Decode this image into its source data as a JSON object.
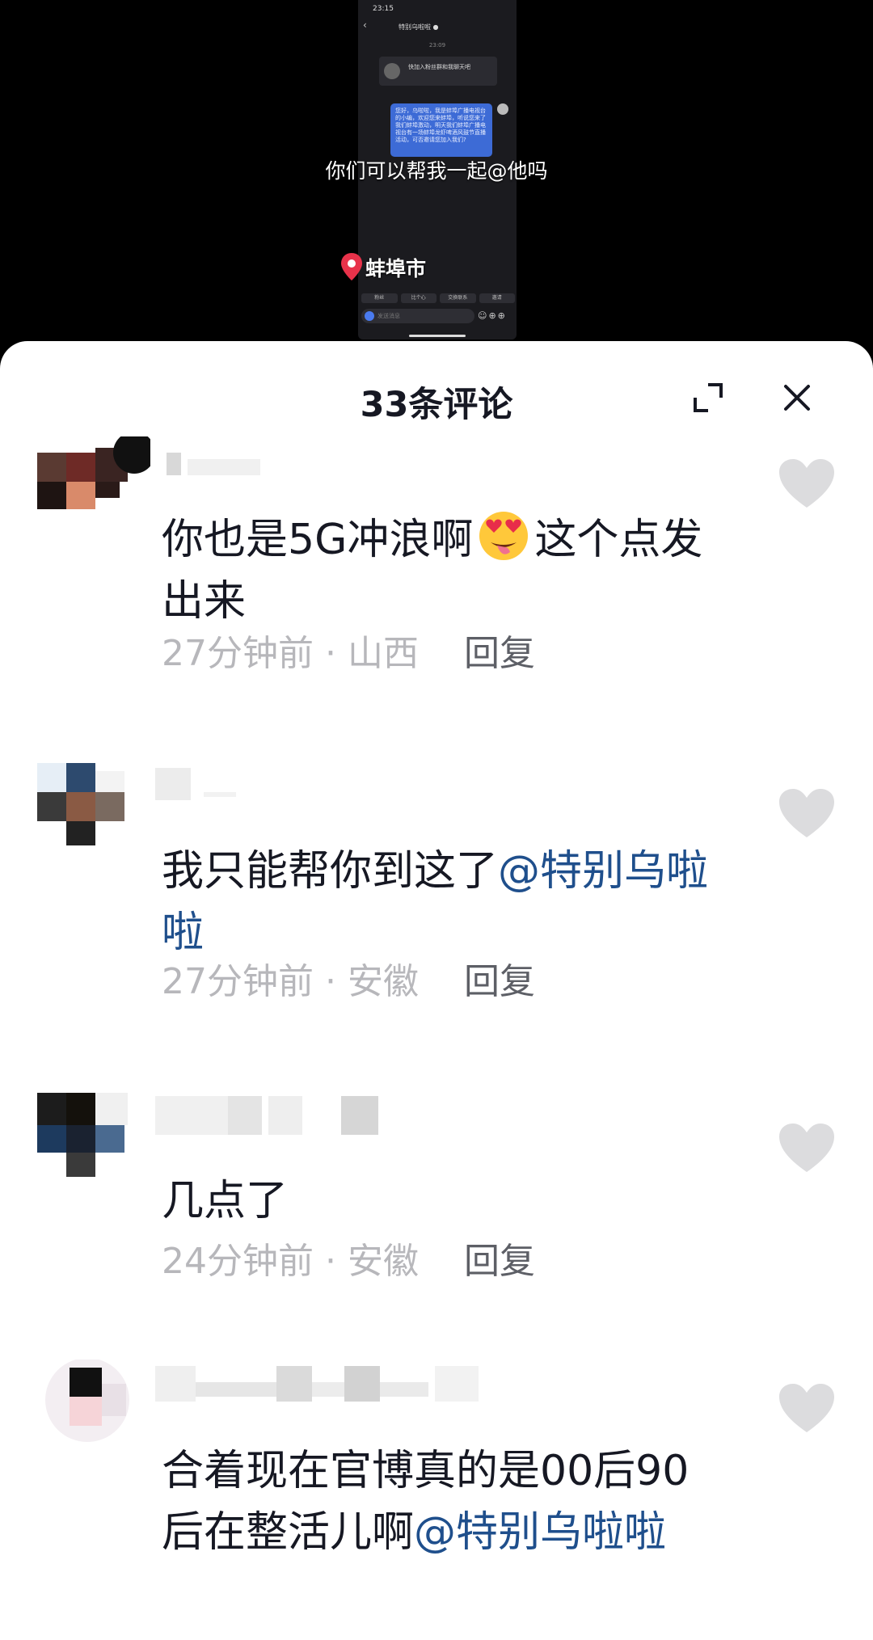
{
  "video": {
    "phone_status": "23:15",
    "phone_title": "特别乌啦啦 ●",
    "phone_date": "23:09",
    "phone_card_text": "快加入粉丝群和我聊天吧",
    "phone_bubble_text": "您好，乌啦啦，我是蚌埠广播电视台的小编，欢迎您来蚌埠，听说您来了我们蚌埠激动，明天我们蚌埠广播电视台有一场蚌埠龙虾啤酒风鼓节直播活动，可否邀请您加入我们?",
    "phone_chips": [
      "粉丝",
      "比个心",
      "交换联系",
      "邀请"
    ],
    "phone_input_placeholder": "发送消息",
    "caption": "你们可以帮我一起@他吗",
    "location": "蚌埠市"
  },
  "sheet": {
    "title": "33条评论"
  },
  "comments": [
    {
      "text": "你也是5G冲浪啊",
      "text_after_emoji": "这个点发出来",
      "mention": "",
      "time": "27分钟前",
      "region": "山西",
      "reply": "回复"
    },
    {
      "text": "我只能帮你到这了",
      "mention": "@特别乌啦啦",
      "time": "27分钟前",
      "region": "安徽",
      "reply": "回复"
    },
    {
      "text": "几点了",
      "mention": "",
      "time": "24分钟前",
      "region": "安徽",
      "reply": "回复"
    },
    {
      "text": "合着现在官博真的是00后90后在整活儿啊",
      "mention": "@特别乌啦啦",
      "time": "",
      "region": "",
      "reply": ""
    }
  ],
  "colors": {
    "mention": "#1f4f8c",
    "meta": "#b7b7bb",
    "reply": "#5d5f66",
    "like": "#dcdcde"
  }
}
